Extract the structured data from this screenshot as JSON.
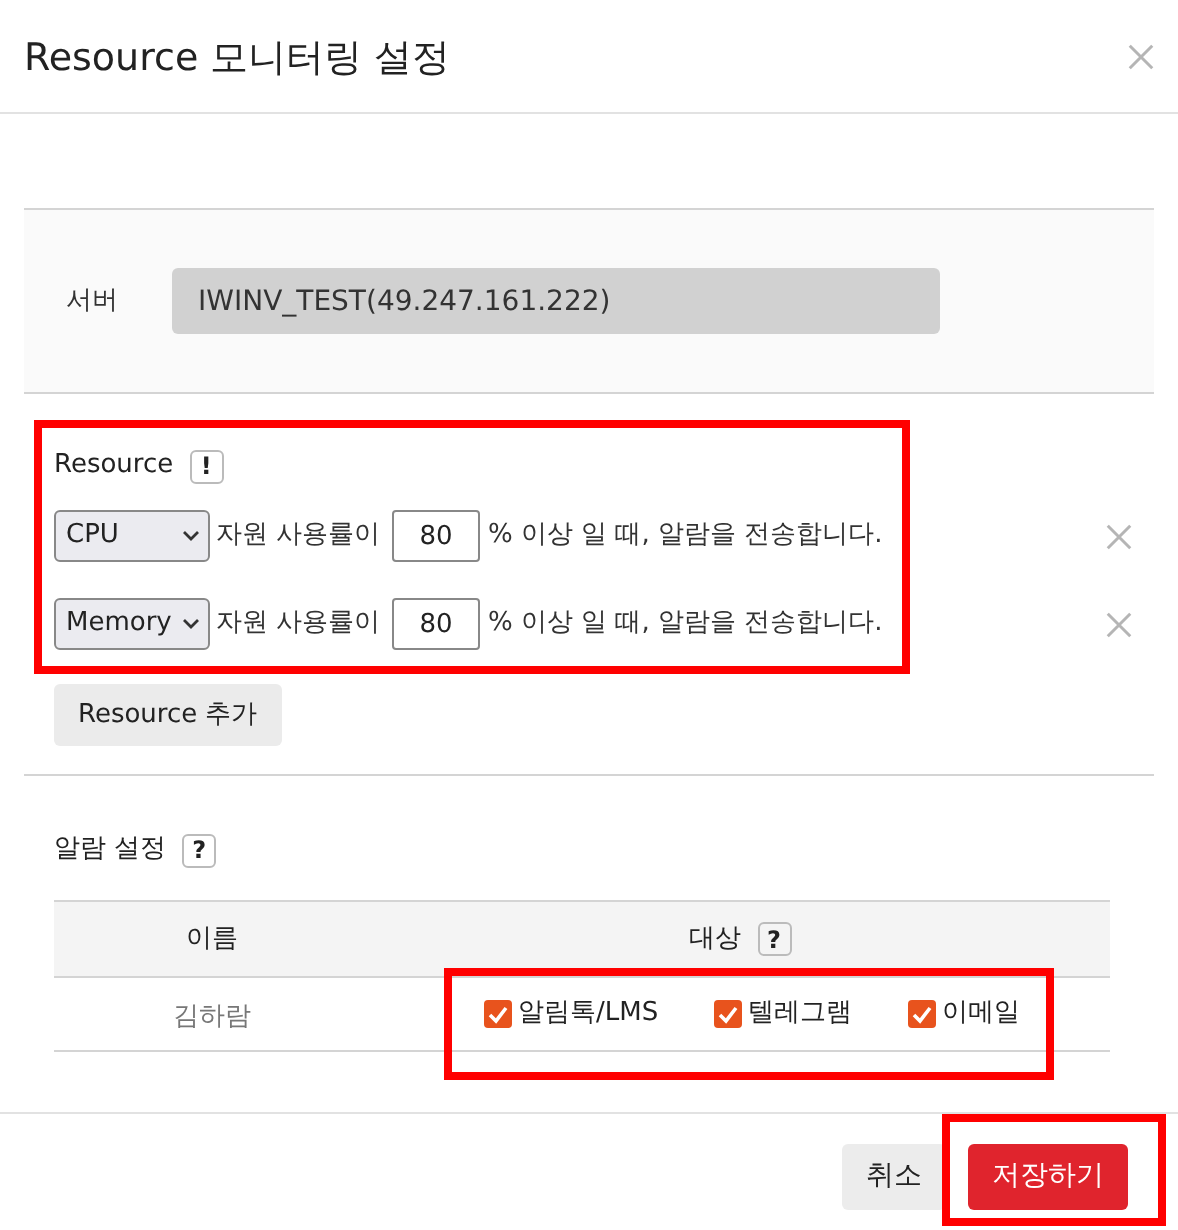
{
  "dialog": {
    "title": "Resource 모니터링 설정"
  },
  "server": {
    "label": "서버",
    "value": "IWINV_TEST(49.247.161.222)"
  },
  "resource": {
    "label": "Resource",
    "hint": "!",
    "rows": [
      {
        "metric": "CPU",
        "prefix": "자원 사용률이",
        "value": "80",
        "suffix": "% 이상 일 때, 알람을 전송합니다."
      },
      {
        "metric": "Memory",
        "prefix": "자원 사용률이",
        "value": "80",
        "suffix": "% 이상 일 때, 알람을 전송합니다."
      }
    ],
    "add_button": "Resource 추가"
  },
  "alarm": {
    "label": "알람 설정",
    "hint": "?",
    "table": {
      "columns": [
        {
          "label": "이름"
        },
        {
          "label": "대상",
          "hint": "?"
        }
      ],
      "rows": [
        {
          "name": "김하람",
          "targets": [
            {
              "label": "알림톡/LMS",
              "checked": true
            },
            {
              "label": "텔레그램",
              "checked": true
            },
            {
              "label": "이메일",
              "checked": true
            }
          ]
        }
      ]
    }
  },
  "buttons": [
    {
      "label": "취소",
      "kind": "secondary"
    },
    {
      "label": "저장하기",
      "kind": "primary"
    }
  ]
}
